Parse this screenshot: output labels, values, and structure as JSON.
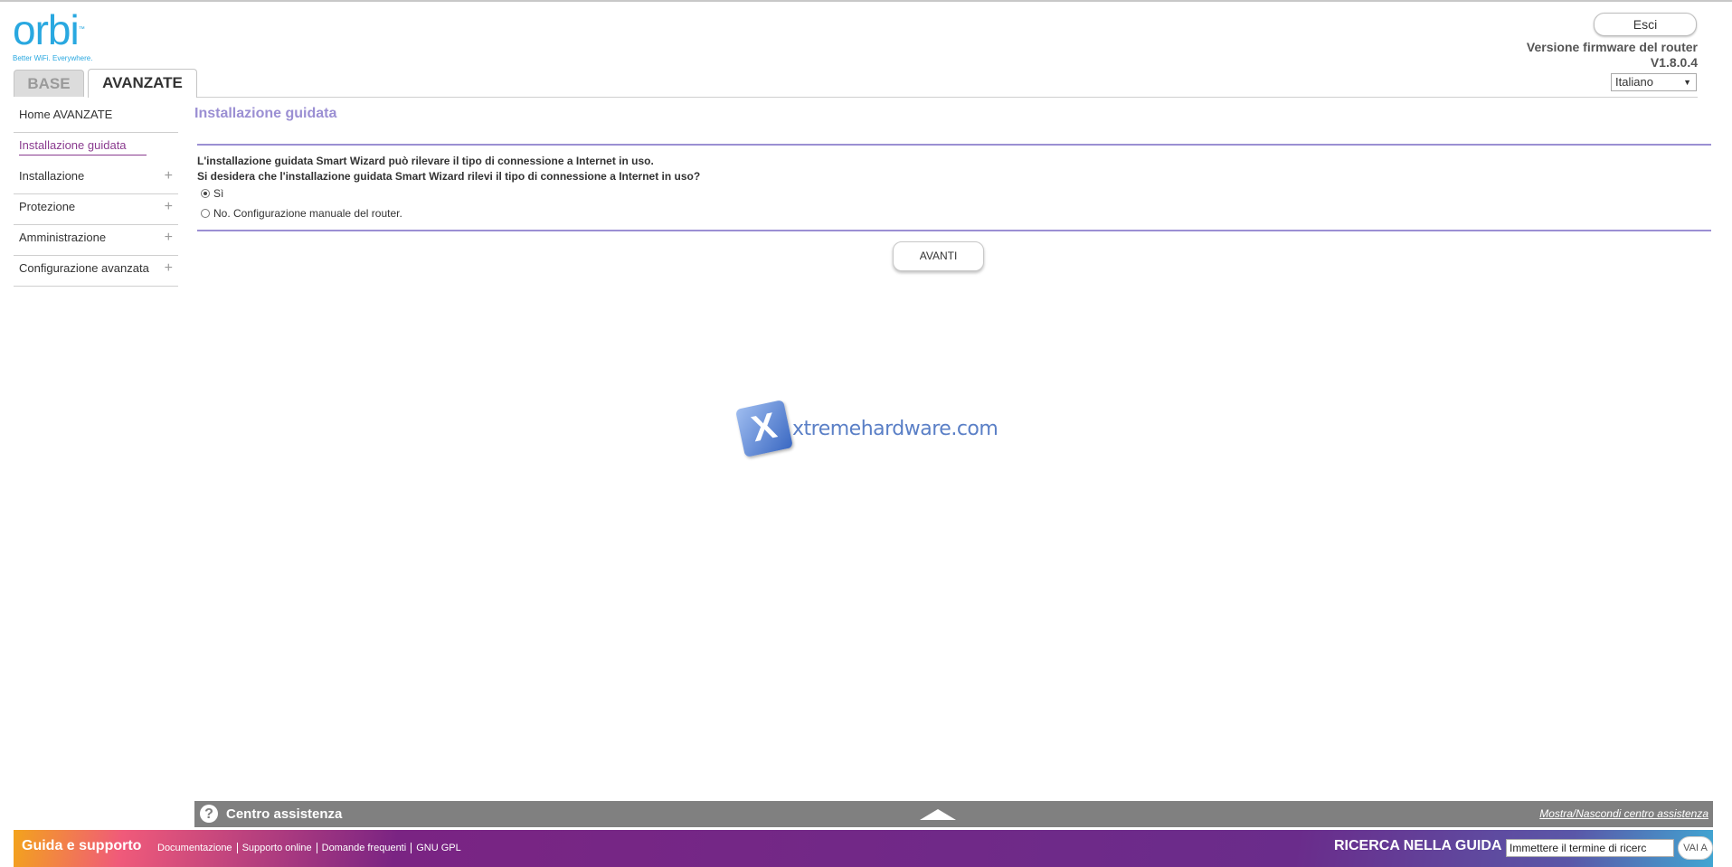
{
  "brand": {
    "logo_text": "orbi",
    "logo_tm": "™",
    "tagline": "Better WiFi. Everywhere."
  },
  "tabs": [
    {
      "label": "BASE",
      "active": false
    },
    {
      "label": "AVANZATE",
      "active": true
    }
  ],
  "header": {
    "logout_label": "Esci",
    "firmware_label": "Versione firmware del router",
    "firmware_version": "V1.8.0.4",
    "language_selected": "Italiano"
  },
  "sidebar": {
    "items": [
      {
        "label": "Home AVANZATE",
        "expandable": false
      },
      {
        "label": "Installazione guidata",
        "expandable": false,
        "active": true
      },
      {
        "label": "Installazione",
        "expandable": true
      },
      {
        "label": "Protezione",
        "expandable": true
      },
      {
        "label": "Amministrazione",
        "expandable": true
      },
      {
        "label": "Configurazione avanzata",
        "expandable": true
      }
    ],
    "expand_symbol": "+"
  },
  "main": {
    "title": "Installazione guidata",
    "line1": "L'installazione guidata Smart Wizard può rilevare il tipo di connessione a Internet in uso.",
    "line2": "Si desidera che l'installazione guidata Smart Wizard rilevi il tipo di connessione a Internet in uso?",
    "option_yes": "Sì",
    "option_no": "No. Configurazione manuale del router.",
    "selected": "yes",
    "next_label": "AVANTI"
  },
  "watermark": {
    "mark": "X",
    "text": "xtremehardware.com"
  },
  "help_center": {
    "icon": "?",
    "title": "Centro assistenza",
    "toggle_label": "Mostra/Nascondi centro assistenza"
  },
  "footer": {
    "title": "Guida e supporto",
    "links": [
      "Documentazione",
      "Supporto online",
      "Domande frequenti",
      "GNU GPL"
    ],
    "search_label": "RICERCA NELLA GUIDA",
    "search_value": "Immettere il termine di ricerc",
    "search_button": "VAI A"
  },
  "colors": {
    "accent": "#9b8fd3",
    "active_link": "#8a3b8f",
    "logo": "#29a8e0",
    "footer_purple": "#6a2c8b"
  }
}
